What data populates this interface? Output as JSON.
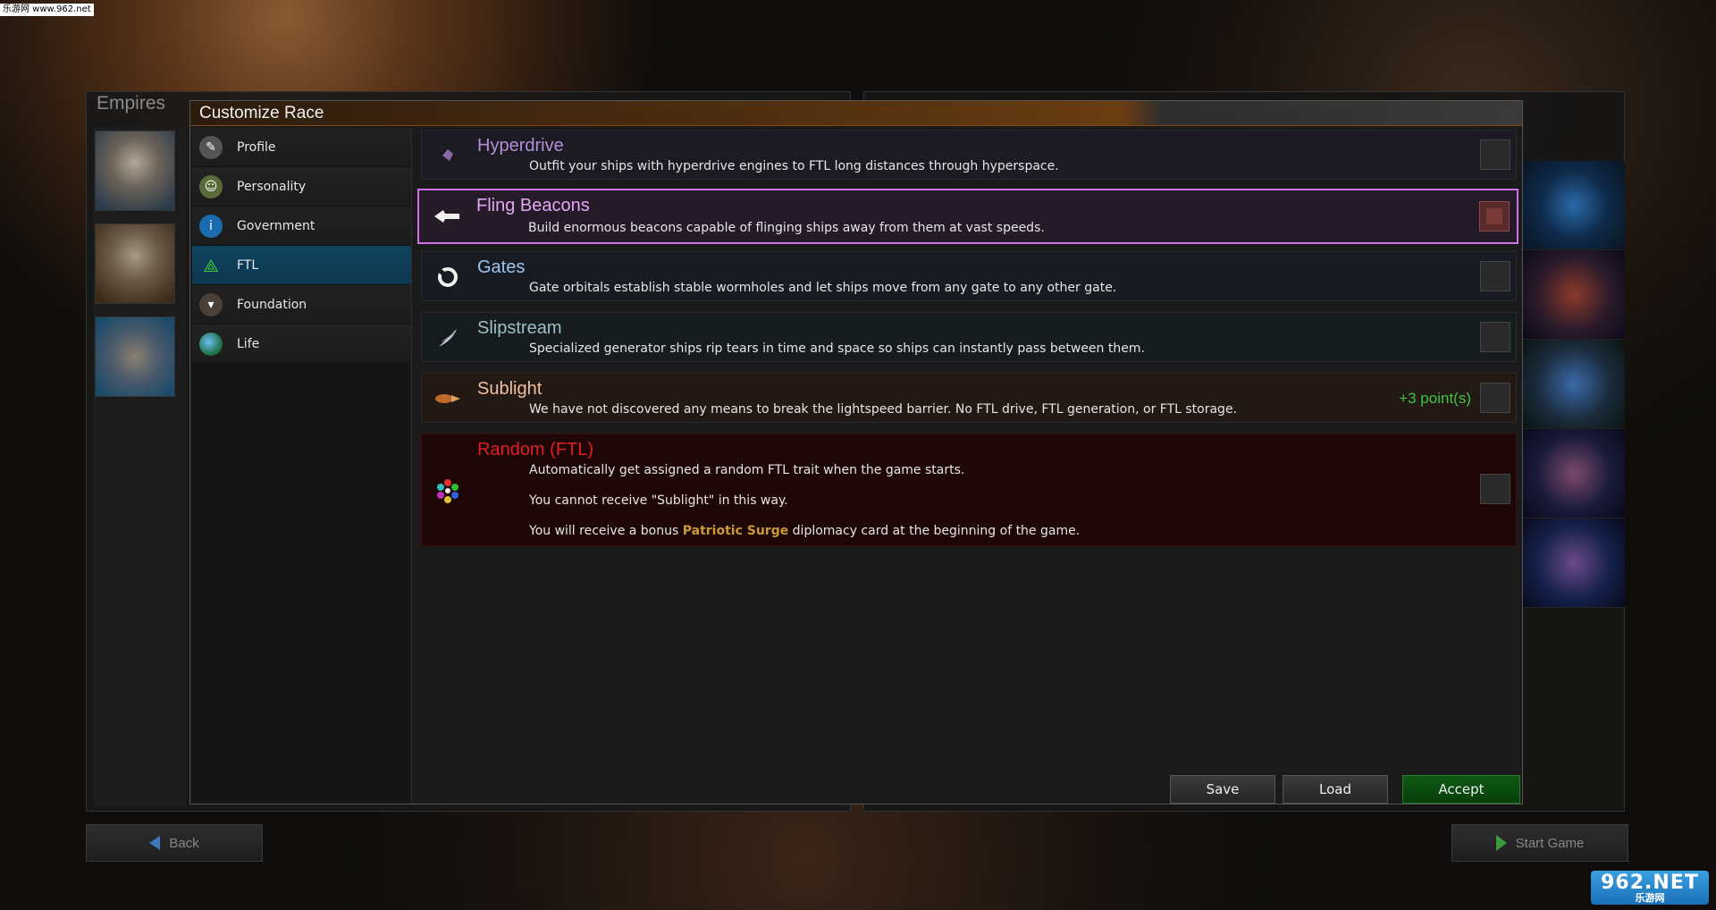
{
  "watermark_top": "乐游网 www.962.net",
  "watermark_bottom": {
    "big": "962.NET",
    "small": "乐游网"
  },
  "empires_title": "Empires",
  "back_label": "Back",
  "start_label": "Start Game",
  "dialog": {
    "title": "Customize Race",
    "nav": [
      {
        "label": "Profile",
        "icon": "profile-icon",
        "color": "#666"
      },
      {
        "label": "Personality",
        "icon": "personality-icon",
        "color": "#5a6a3a"
      },
      {
        "label": "Government",
        "icon": "government-icon",
        "color": "#1a6ab0"
      },
      {
        "label": "FTL",
        "icon": "ftl-icon",
        "color": "#2a8a2a",
        "active": true
      },
      {
        "label": "Foundation",
        "icon": "foundation-icon",
        "color": "#5a4a3a"
      },
      {
        "label": "Life",
        "icon": "life-icon",
        "color": "#2a7ac0"
      }
    ],
    "traits": [
      {
        "name": "Hyperdrive",
        "name_color": "#b590d8",
        "bg": "#1c1a22",
        "desc": "Outfit your ships with hyperdrive engines to FTL long distances through hyperspace.",
        "icon": "hyperdrive-icon",
        "selected": false
      },
      {
        "name": "Fling Beacons",
        "name_color": "#e4a8f4",
        "bg": "#241a28",
        "desc": "Build enormous beacons capable of flinging ships away from them at vast speeds.",
        "icon": "fling-beacon-icon",
        "selected": true
      },
      {
        "name": "Gates",
        "name_color": "#9ec6ee",
        "bg": "#181c22",
        "desc": "Gate orbitals establish stable wormholes and let ships move from any gate to any other gate.",
        "icon": "gate-icon",
        "selected": false
      },
      {
        "name": "Slipstream",
        "name_color": "#9cc0c8",
        "bg": "#161c1e",
        "desc": "Specialized generator ships rip tears in time and space so ships can instantly pass between them.",
        "icon": "slipstream-icon",
        "selected": false
      },
      {
        "name": "Sublight",
        "name_color": "#f0c0a0",
        "bg": "#221814",
        "desc": "We have not discovered any means to break the lightspeed barrier. No FTL drive, FTL generation, or FTL storage.",
        "icon": "sublight-icon",
        "selected": false,
        "points": "+3 point(s)"
      },
      {
        "name": "Random (FTL)",
        "name_color": "#e02020",
        "bg": "#1e0606",
        "desc1": "Automatically get assigned a random FTL trait when the game starts.",
        "desc2": "You cannot receive \"Sublight\" in this way.",
        "desc3_pre": "You will receive a bonus ",
        "desc3_hl": "Patriotic Surge",
        "desc3_post": " diplomacy card at the beginning of the game.",
        "icon": "random-icon",
        "selected": false
      }
    ],
    "buttons": {
      "save": "Save",
      "load": "Load",
      "accept": "Accept"
    }
  }
}
